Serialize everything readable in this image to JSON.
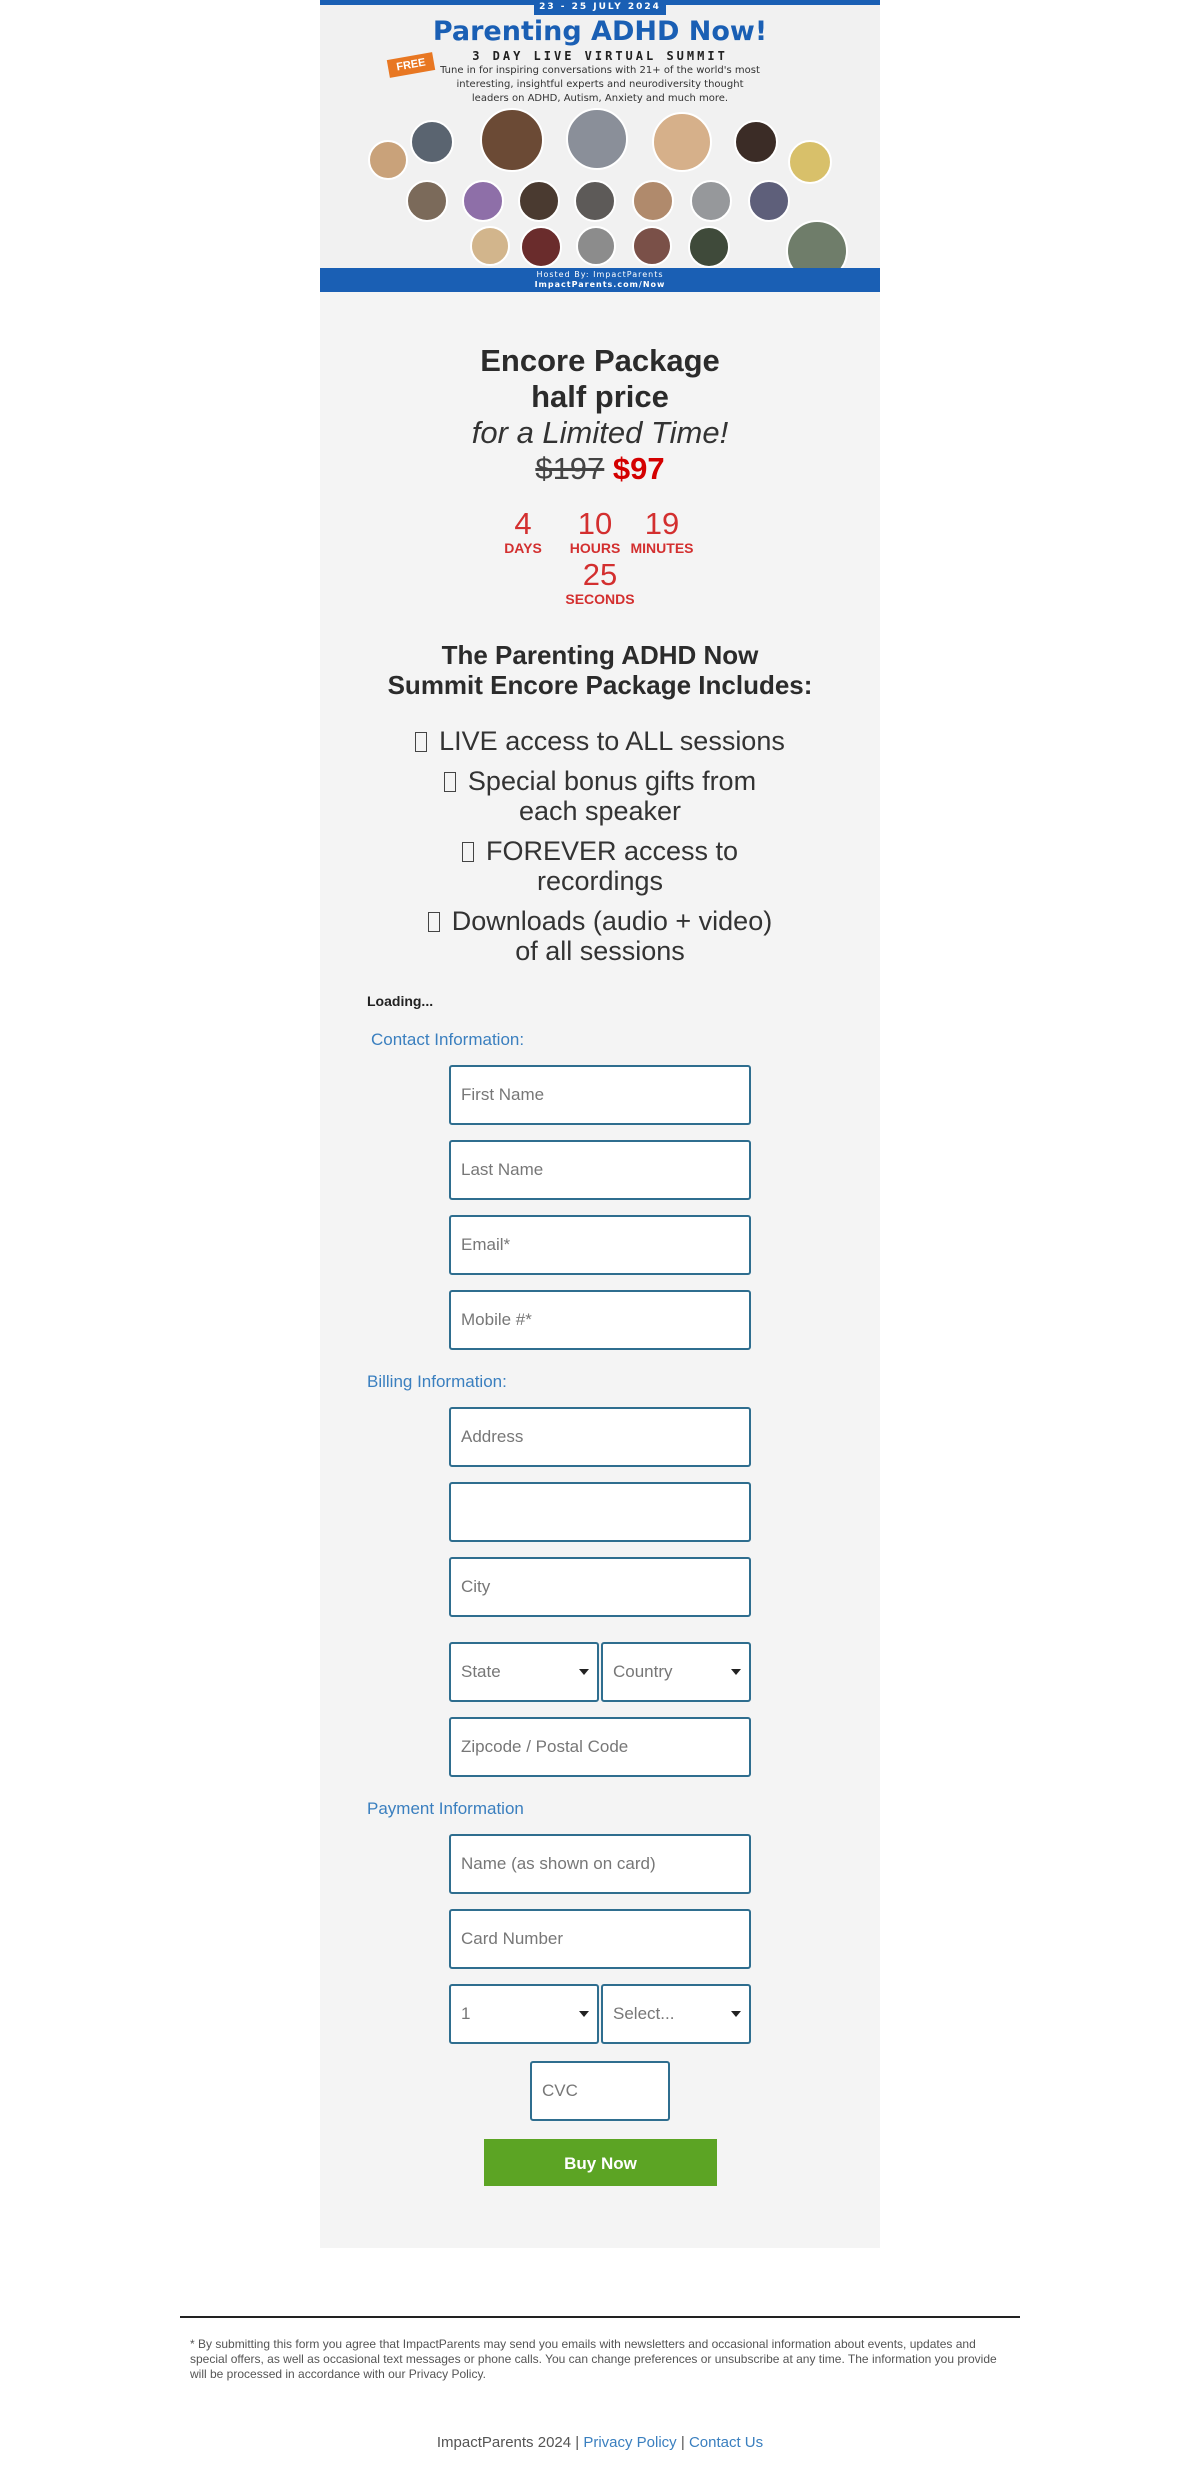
{
  "banner": {
    "dates": "23 - 25 JULY 2024",
    "title": "Parenting ADHD Now!",
    "subtitle": "3 DAY LIVE VIRTUAL SUMMIT",
    "badge": "FREE",
    "description": "Tune in for inspiring conversations with 21+ of the world's most interesting, insightful experts and neurodiversity thought leaders on ADHD, Autism, Anxiety and much more.",
    "host": "Hosted By: ImpactParents",
    "url": "ImpactParents.com/Now"
  },
  "offer": {
    "headline_1": "Encore Package",
    "headline_2": "half price",
    "limited": "for a Limited Time!",
    "old_price": "$197",
    "new_price": "$97"
  },
  "countdown": {
    "days": "4",
    "days_label": "DAYS",
    "hours": "10",
    "hours_label": "HOURS",
    "minutes": "19",
    "minutes_label": "MINUTES",
    "seconds": "25",
    "seconds_label": "SECONDS"
  },
  "includes": {
    "title_1": "The Parenting ADHD Now",
    "title_2": "Summit Encore Package Includes:",
    "items": [
      {
        "line1": "LIVE access to ALL sessions",
        "line2": ""
      },
      {
        "line1": "Special bonus gifts from",
        "line2": "each speaker"
      },
      {
        "line1": "FOREVER access to",
        "line2": "recordings"
      },
      {
        "line1": "Downloads (audio + video)",
        "line2": "of all sessions"
      }
    ]
  },
  "form": {
    "loading": "Loading...",
    "contact_label": "Contact Information:",
    "first_name": "First Name",
    "last_name": "Last Name",
    "email": "Email*",
    "mobile": "Mobile #*",
    "billing_label": "Billing Information:",
    "address": "Address",
    "address2": "",
    "city": "City",
    "state": "State",
    "country": "Country",
    "zipcode": "Zipcode / Postal Code",
    "payment_label": "Payment Information",
    "card_name": "Name (as shown on card)",
    "card_number": "Card Number",
    "exp_month": "1",
    "exp_year": "Select...",
    "cvc": "CVC",
    "buy_button": "Buy Now"
  },
  "footer": {
    "disclaimer": "* By submitting this form you agree that ImpactParents may send you emails with newsletters and occasional information about events, updates and special offers, as well as occasional text messages or phone calls. You can change preferences or unsubscribe at any time. The information you provide will be processed in accordance with our Privacy Policy.",
    "copyright": "ImpactParents 2024 |",
    "privacy": "Privacy Policy",
    "separator": "|",
    "contact": "Contact Us"
  },
  "colors": {
    "brand_blue": "#1a5fb4",
    "price_red": "#d40000",
    "countdown_red": "#d32f2f",
    "label_blue": "#3a7fbf",
    "buy_green": "#5ca424",
    "field_border": "#2f6e8f"
  }
}
